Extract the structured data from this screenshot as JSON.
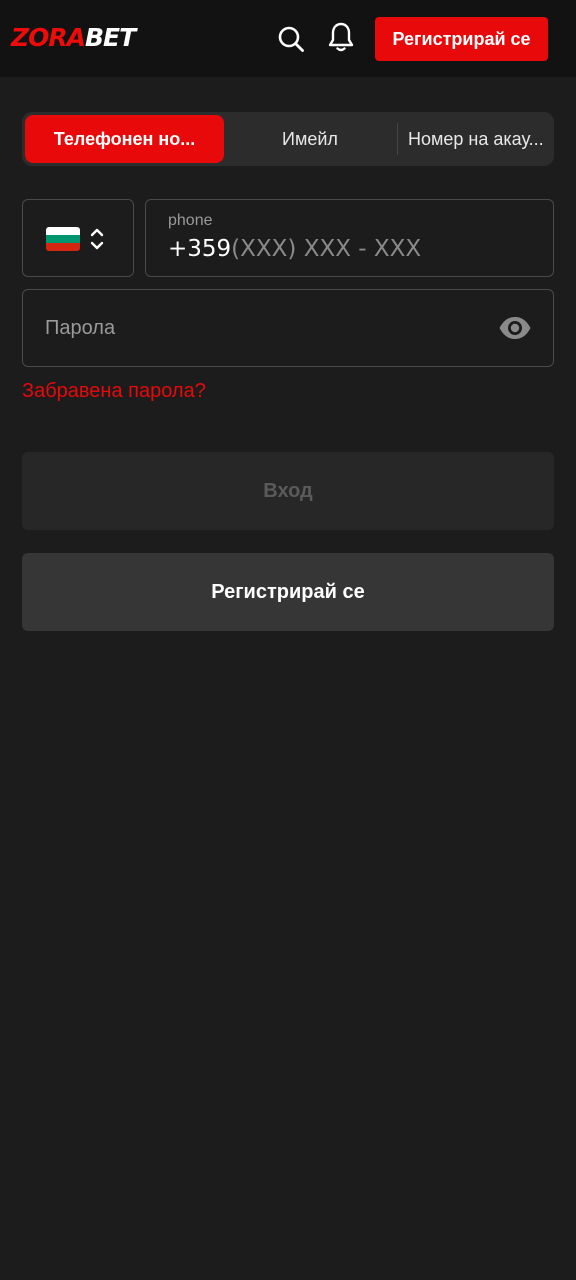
{
  "header": {
    "logo_part1": "ZORA",
    "logo_part2": "BET",
    "search_icon": "search-icon",
    "bell_icon": "bell-icon",
    "register_label": "Регистрирай се"
  },
  "tabs": [
    {
      "label": "Телефонен но...",
      "active": true
    },
    {
      "label": "Имейл",
      "active": false
    },
    {
      "label": "Номер на акау...",
      "active": false
    }
  ],
  "country": {
    "flag": "bulgaria-flag",
    "flag_colors": [
      "#ffffff",
      "#00966e",
      "#d62612"
    ],
    "selector_icon": "chevron-updown-icon"
  },
  "phone": {
    "label": "phone",
    "code": "+359",
    "mask": "(XXX) XXX - XXX"
  },
  "password": {
    "placeholder": "Парола",
    "visibility_icon": "eye-icon"
  },
  "forgot_label": "Забравена парола?",
  "login_label": "Вход",
  "register_label": "Регистрирай се",
  "colors": {
    "accent": "#e8090b",
    "background": "#1c1c1c",
    "header_bg": "#121212"
  }
}
